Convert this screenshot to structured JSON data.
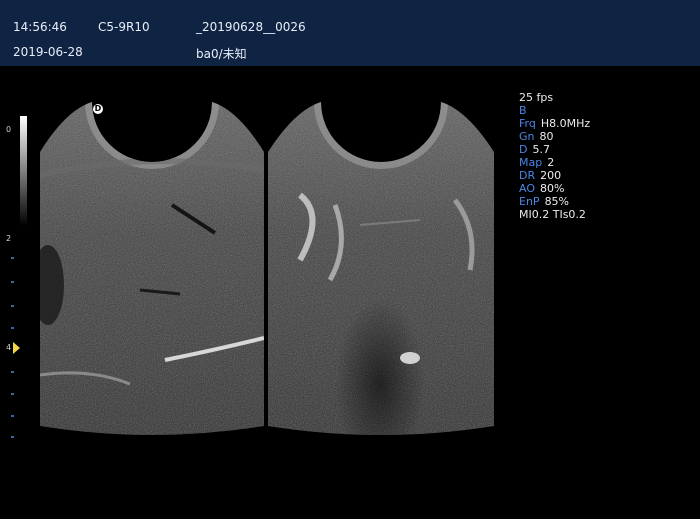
{
  "header": {
    "time": "14:56:46",
    "date": "2019-06-28",
    "probe": "C5-9R10",
    "exam_id": "_20190628__0026",
    "patient": "ba0/未知"
  },
  "scale": {
    "depth_labels": [
      "0",
      "2",
      "4"
    ]
  },
  "orientation_marker": "D",
  "params": {
    "fps": "25 fps",
    "mode": "B",
    "frq": {
      "key": "Frq",
      "value": "H8.0MHz"
    },
    "gn": {
      "key": "Gn",
      "value": "80"
    },
    "d": {
      "key": "D",
      "value": "5.7"
    },
    "map": {
      "key": "Map",
      "value": "2"
    },
    "dr": {
      "key": "DR",
      "value": "200"
    },
    "ao": {
      "key": "AO",
      "value": "80%"
    },
    "enp": {
      "key": "EnP",
      "value": "85%"
    },
    "mi_ti": "MI0.2 TIs0.2"
  }
}
